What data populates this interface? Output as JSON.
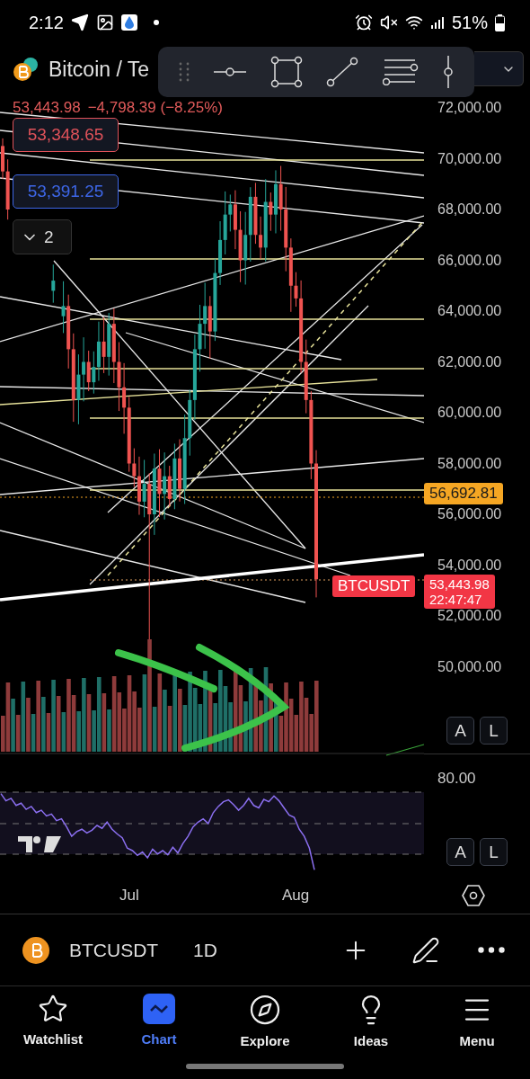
{
  "status_bar": {
    "time": "2:12",
    "battery": "51%"
  },
  "symbol_header": {
    "title": "Bitcoin / Te",
    "price": "53,443.98",
    "change": "−4,798.39 (−8.25%)"
  },
  "order_buttons": [
    {
      "text": "53,348.65",
      "kind": "sell"
    },
    {
      "text": "53,391.25",
      "kind": "buy"
    }
  ],
  "indicator_toggle": {
    "count": "2"
  },
  "price_axis": [
    "72,000.00",
    "70,000.00",
    "68,000.00",
    "66,000.00",
    "64,000.00",
    "62,000.00",
    "60,000.00",
    "58,000.00",
    "56,000.00",
    "54,000.00",
    "52,000.00",
    "50,000.00"
  ],
  "level_tag": {
    "text": "56,692.81"
  },
  "last_price": {
    "symbol": "BTCUSDT",
    "price": "53,443.98",
    "countdown": "22:47:47"
  },
  "price_pane_buttons": [
    "A",
    "L"
  ],
  "rsi_axis": "80.00",
  "rsi_pane_buttons": [
    "A",
    "L"
  ],
  "time_axis": [
    "Jul",
    "Aug"
  ],
  "symbol_bar": {
    "symbol": "BTCUSDT",
    "interval": "1D"
  },
  "tab_bar": [
    {
      "label": "Watchlist",
      "kind": "star",
      "selected": false
    },
    {
      "label": "Chart",
      "kind": "chart",
      "selected": true
    },
    {
      "label": "Explore",
      "kind": "compass",
      "selected": false
    },
    {
      "label": "Ideas",
      "kind": "bulb",
      "selected": false
    },
    {
      "label": "Menu",
      "kind": "menu",
      "selected": false
    }
  ]
}
